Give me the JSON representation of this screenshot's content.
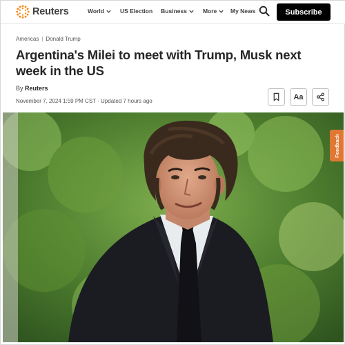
{
  "header": {
    "logo_text": "Reuters",
    "nav": [
      {
        "label": "World",
        "has_dropdown": true
      },
      {
        "label": "US Election",
        "has_dropdown": false
      },
      {
        "label": "Business",
        "has_dropdown": true
      },
      {
        "label": "More",
        "has_dropdown": true
      }
    ],
    "my_news": "My News",
    "subscribe": "Subscribe",
    "brand_color": "#ff8000"
  },
  "article": {
    "breadcrumbs": [
      "Americas",
      "Donald Trump"
    ],
    "title": "Argentina's Milei to meet with Trump, Musk next week in the US",
    "byline_prefix": "By",
    "author": "Reuters",
    "dateline": "November 7, 2024 1:59 PM CST · Updated 7 hours ago",
    "tools": {
      "bookmark_icon": "bookmark-icon",
      "text_size_label": "Aa",
      "share_icon": "share-icon"
    }
  },
  "hero_image": {
    "description_icon": "photo"
  },
  "feedback": {
    "label": "Feedback",
    "color": "#e07833"
  }
}
